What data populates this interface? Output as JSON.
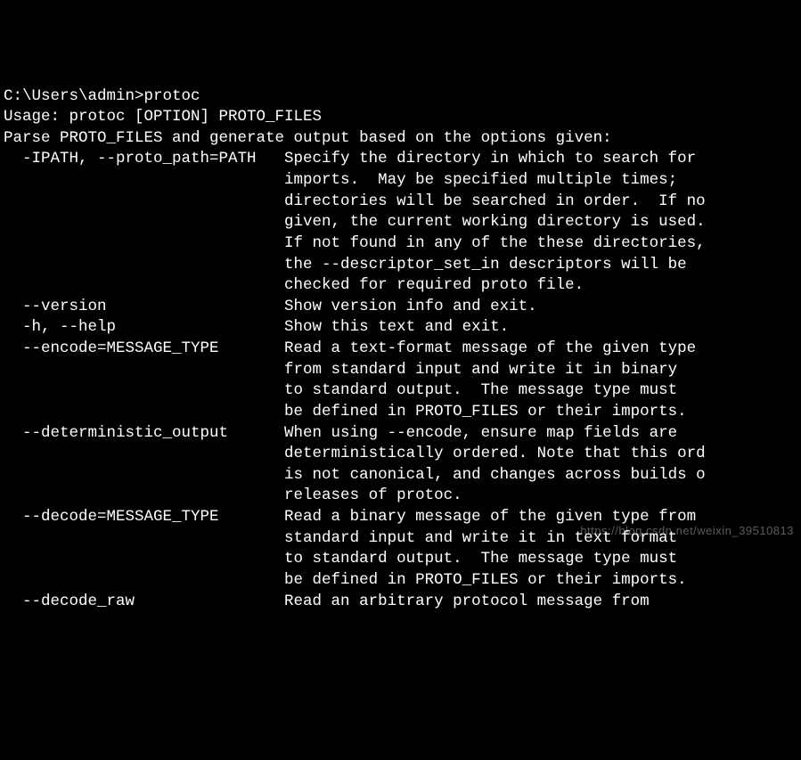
{
  "terminal": {
    "prompt": "C:\\Users\\admin>",
    "command": "protoc",
    "lines": [
      "C:\\Users\\admin>protoc",
      "Usage: protoc [OPTION] PROTO_FILES",
      "Parse PROTO_FILES and generate output based on the options given:",
      "  -IPATH, --proto_path=PATH   Specify the directory in which to search for",
      "                              imports.  May be specified multiple times;",
      "                              directories will be searched in order.  If no",
      "                              given, the current working directory is used.",
      "                              If not found in any of the these directories,",
      "                              the --descriptor_set_in descriptors will be",
      "                              checked for required proto file.",
      "  --version                   Show version info and exit.",
      "  -h, --help                  Show this text and exit.",
      "  --encode=MESSAGE_TYPE       Read a text-format message of the given type",
      "                              from standard input and write it in binary",
      "                              to standard output.  The message type must",
      "                              be defined in PROTO_FILES or their imports.",
      "  --deterministic_output      When using --encode, ensure map fields are",
      "                              deterministically ordered. Note that this ord",
      "                              is not canonical, and changes across builds o",
      "                              releases of protoc.",
      "  --decode=MESSAGE_TYPE       Read a binary message of the given type from",
      "                              standard input and write it in text format",
      "                              to standard output.  The message type must",
      "                              be defined in PROTO_FILES or their imports.",
      "  --decode_raw                Read an arbitrary protocol message from"
    ]
  },
  "watermark": "https://blog.csdn.net/weixin_39510813"
}
